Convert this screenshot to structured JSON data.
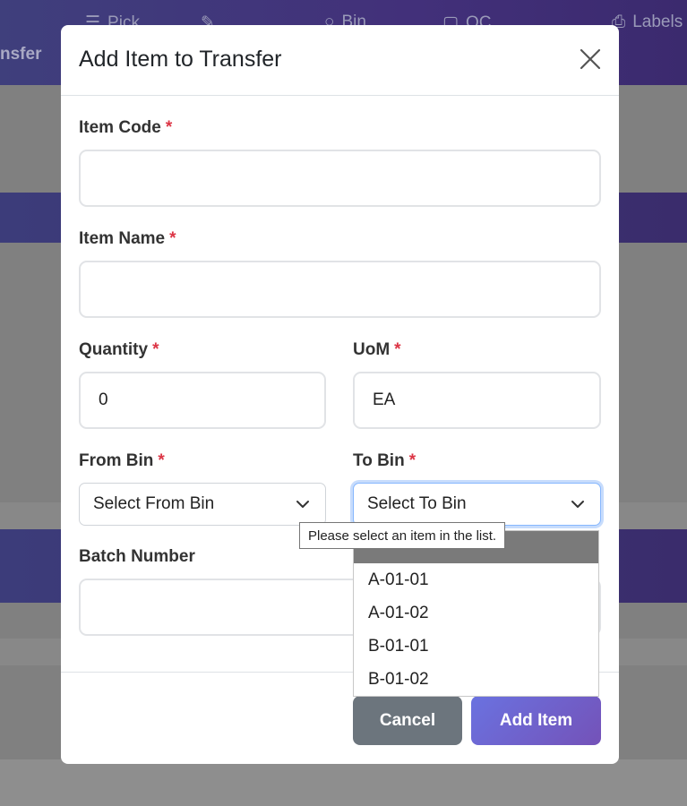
{
  "background": {
    "nav_items": [
      "Pick",
      "Bin",
      "QC",
      "Labels"
    ],
    "nav_left": "nsfer"
  },
  "modal": {
    "title": "Add Item to Transfer",
    "close_icon": "close-icon",
    "fields": {
      "item_code": {
        "label": "Item Code",
        "required": "*",
        "value": ""
      },
      "item_name": {
        "label": "Item Name",
        "required": "*",
        "value": ""
      },
      "quantity": {
        "label": "Quantity",
        "required": "*",
        "value": "0"
      },
      "uom": {
        "label": "UoM",
        "required": "*",
        "value": "EA"
      },
      "from_bin": {
        "label": "From Bin",
        "required": "*",
        "value": "Select From Bin"
      },
      "to_bin": {
        "label": "To Bin",
        "required": "*",
        "value": "Select To Bin"
      },
      "batch_number": {
        "label": "Batch Number",
        "value": ""
      }
    },
    "to_bin_options": [
      "Select To Bin",
      "A-01-01",
      "A-01-02",
      "B-01-01",
      "B-01-02"
    ],
    "validation_tooltip": "Please select an item in the list.",
    "buttons": {
      "cancel": "Cancel",
      "add": "Add Item"
    }
  },
  "colors": {
    "required": "#dc3545",
    "cancel_button": "#6c757d",
    "add_button_start": "#6a72e0",
    "add_button_end": "#7452b8",
    "focus_ring": "#86b7fe"
  }
}
